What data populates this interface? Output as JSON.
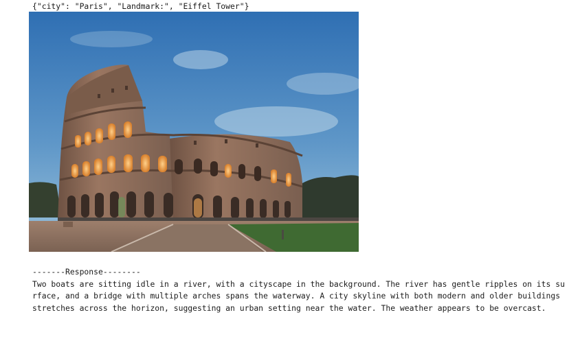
{
  "input_line": "{\"city\": \"Paris\", \"Landmark:\", \"Eiffel Tower\"}",
  "image": {
    "subject": "colosseum-photo"
  },
  "response": {
    "header": "-------Response--------",
    "text": "Two boats are sitting idle in a river, with a cityscape in the background. The river has gentle ripples on its surface, and a bridge with multiple arches spans the waterway. A city skyline with both modern and older buildings stretches across the horizon, suggesting an urban setting near the water.  The weather appears to be overcast."
  },
  "colors": {
    "sky_top": "#3a78b8",
    "sky_bottom": "#8fbbd8",
    "stone": "#8a6a55",
    "arch_light": "#f0a24a",
    "grass": "#3f6a32"
  }
}
